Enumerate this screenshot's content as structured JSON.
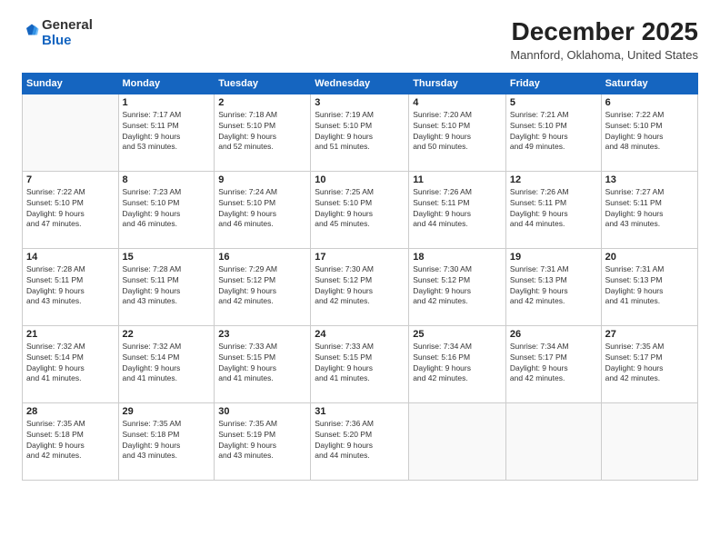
{
  "header": {
    "logo": {
      "general": "General",
      "blue": "Blue"
    },
    "title": "December 2025",
    "location": "Mannford, Oklahoma, United States"
  },
  "calendar": {
    "days_of_week": [
      "Sunday",
      "Monday",
      "Tuesday",
      "Wednesday",
      "Thursday",
      "Friday",
      "Saturday"
    ],
    "weeks": [
      [
        {
          "day": "",
          "sunrise": "",
          "sunset": "",
          "daylight": ""
        },
        {
          "day": "1",
          "sunrise": "Sunrise: 7:17 AM",
          "sunset": "Sunset: 5:11 PM",
          "daylight": "Daylight: 9 hours and 53 minutes."
        },
        {
          "day": "2",
          "sunrise": "Sunrise: 7:18 AM",
          "sunset": "Sunset: 5:10 PM",
          "daylight": "Daylight: 9 hours and 52 minutes."
        },
        {
          "day": "3",
          "sunrise": "Sunrise: 7:19 AM",
          "sunset": "Sunset: 5:10 PM",
          "daylight": "Daylight: 9 hours and 51 minutes."
        },
        {
          "day": "4",
          "sunrise": "Sunrise: 7:20 AM",
          "sunset": "Sunset: 5:10 PM",
          "daylight": "Daylight: 9 hours and 50 minutes."
        },
        {
          "day": "5",
          "sunrise": "Sunrise: 7:21 AM",
          "sunset": "Sunset: 5:10 PM",
          "daylight": "Daylight: 9 hours and 49 minutes."
        },
        {
          "day": "6",
          "sunrise": "Sunrise: 7:22 AM",
          "sunset": "Sunset: 5:10 PM",
          "daylight": "Daylight: 9 hours and 48 minutes."
        }
      ],
      [
        {
          "day": "7",
          "sunrise": "Sunrise: 7:22 AM",
          "sunset": "Sunset: 5:10 PM",
          "daylight": "Daylight: 9 hours and 47 minutes."
        },
        {
          "day": "8",
          "sunrise": "Sunrise: 7:23 AM",
          "sunset": "Sunset: 5:10 PM",
          "daylight": "Daylight: 9 hours and 46 minutes."
        },
        {
          "day": "9",
          "sunrise": "Sunrise: 7:24 AM",
          "sunset": "Sunset: 5:10 PM",
          "daylight": "Daylight: 9 hours and 46 minutes."
        },
        {
          "day": "10",
          "sunrise": "Sunrise: 7:25 AM",
          "sunset": "Sunset: 5:10 PM",
          "daylight": "Daylight: 9 hours and 45 minutes."
        },
        {
          "day": "11",
          "sunrise": "Sunrise: 7:26 AM",
          "sunset": "Sunset: 5:11 PM",
          "daylight": "Daylight: 9 hours and 44 minutes."
        },
        {
          "day": "12",
          "sunrise": "Sunrise: 7:26 AM",
          "sunset": "Sunset: 5:11 PM",
          "daylight": "Daylight: 9 hours and 44 minutes."
        },
        {
          "day": "13",
          "sunrise": "Sunrise: 7:27 AM",
          "sunset": "Sunset: 5:11 PM",
          "daylight": "Daylight: 9 hours and 43 minutes."
        }
      ],
      [
        {
          "day": "14",
          "sunrise": "Sunrise: 7:28 AM",
          "sunset": "Sunset: 5:11 PM",
          "daylight": "Daylight: 9 hours and 43 minutes."
        },
        {
          "day": "15",
          "sunrise": "Sunrise: 7:28 AM",
          "sunset": "Sunset: 5:11 PM",
          "daylight": "Daylight: 9 hours and 43 minutes."
        },
        {
          "day": "16",
          "sunrise": "Sunrise: 7:29 AM",
          "sunset": "Sunset: 5:12 PM",
          "daylight": "Daylight: 9 hours and 42 minutes."
        },
        {
          "day": "17",
          "sunrise": "Sunrise: 7:30 AM",
          "sunset": "Sunset: 5:12 PM",
          "daylight": "Daylight: 9 hours and 42 minutes."
        },
        {
          "day": "18",
          "sunrise": "Sunrise: 7:30 AM",
          "sunset": "Sunset: 5:12 PM",
          "daylight": "Daylight: 9 hours and 42 minutes."
        },
        {
          "day": "19",
          "sunrise": "Sunrise: 7:31 AM",
          "sunset": "Sunset: 5:13 PM",
          "daylight": "Daylight: 9 hours and 42 minutes."
        },
        {
          "day": "20",
          "sunrise": "Sunrise: 7:31 AM",
          "sunset": "Sunset: 5:13 PM",
          "daylight": "Daylight: 9 hours and 41 minutes."
        }
      ],
      [
        {
          "day": "21",
          "sunrise": "Sunrise: 7:32 AM",
          "sunset": "Sunset: 5:14 PM",
          "daylight": "Daylight: 9 hours and 41 minutes."
        },
        {
          "day": "22",
          "sunrise": "Sunrise: 7:32 AM",
          "sunset": "Sunset: 5:14 PM",
          "daylight": "Daylight: 9 hours and 41 minutes."
        },
        {
          "day": "23",
          "sunrise": "Sunrise: 7:33 AM",
          "sunset": "Sunset: 5:15 PM",
          "daylight": "Daylight: 9 hours and 41 minutes."
        },
        {
          "day": "24",
          "sunrise": "Sunrise: 7:33 AM",
          "sunset": "Sunset: 5:15 PM",
          "daylight": "Daylight: 9 hours and 41 minutes."
        },
        {
          "day": "25",
          "sunrise": "Sunrise: 7:34 AM",
          "sunset": "Sunset: 5:16 PM",
          "daylight": "Daylight: 9 hours and 42 minutes."
        },
        {
          "day": "26",
          "sunrise": "Sunrise: 7:34 AM",
          "sunset": "Sunset: 5:17 PM",
          "daylight": "Daylight: 9 hours and 42 minutes."
        },
        {
          "day": "27",
          "sunrise": "Sunrise: 7:35 AM",
          "sunset": "Sunset: 5:17 PM",
          "daylight": "Daylight: 9 hours and 42 minutes."
        }
      ],
      [
        {
          "day": "28",
          "sunrise": "Sunrise: 7:35 AM",
          "sunset": "Sunset: 5:18 PM",
          "daylight": "Daylight: 9 hours and 42 minutes."
        },
        {
          "day": "29",
          "sunrise": "Sunrise: 7:35 AM",
          "sunset": "Sunset: 5:18 PM",
          "daylight": "Daylight: 9 hours and 43 minutes."
        },
        {
          "day": "30",
          "sunrise": "Sunrise: 7:35 AM",
          "sunset": "Sunset: 5:19 PM",
          "daylight": "Daylight: 9 hours and 43 minutes."
        },
        {
          "day": "31",
          "sunrise": "Sunrise: 7:36 AM",
          "sunset": "Sunset: 5:20 PM",
          "daylight": "Daylight: 9 hours and 44 minutes."
        },
        {
          "day": "",
          "sunrise": "",
          "sunset": "",
          "daylight": ""
        },
        {
          "day": "",
          "sunrise": "",
          "sunset": "",
          "daylight": ""
        },
        {
          "day": "",
          "sunrise": "",
          "sunset": "",
          "daylight": ""
        }
      ]
    ]
  }
}
